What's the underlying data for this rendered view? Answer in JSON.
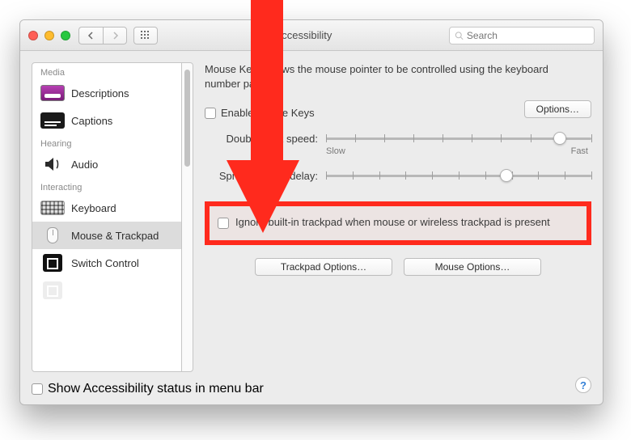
{
  "title": "Accessibility",
  "search": {
    "placeholder": "Search"
  },
  "sidebar": {
    "sections": {
      "media": "Media",
      "hearing": "Hearing",
      "interacting": "Interacting"
    },
    "items": [
      "Descriptions",
      "Captions",
      "Audio",
      "Keyboard",
      "Mouse & Trackpad",
      "Switch Control"
    ],
    "selected_index": 4
  },
  "pane": {
    "description": "Mouse Keys allows the mouse pointer to be controlled using the keyboard number pad.",
    "enable_mouse_keys": "Enable Mouse Keys",
    "options_btn": "Options…",
    "double_click_label": "Double-click speed:",
    "slow": "Slow",
    "fast": "Fast",
    "spring_label": "Spring-loading delay:",
    "ignore_trackpad": "Ignore built-in trackpad when mouse or wireless trackpad is present",
    "trackpad_options_btn": "Trackpad Options…",
    "mouse_options_btn": "Mouse Options…"
  },
  "footer": {
    "show_status": "Show Accessibility status in menu bar"
  }
}
